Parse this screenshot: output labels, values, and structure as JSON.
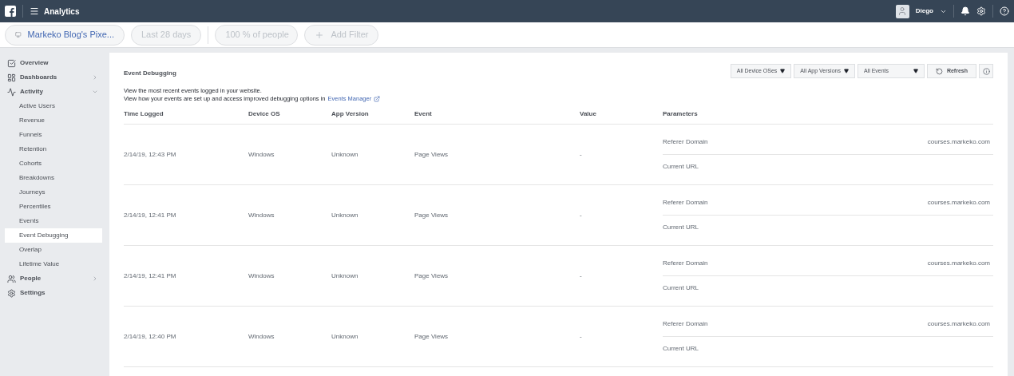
{
  "top_bar": {
    "title": "Analytics",
    "user": "Diego"
  },
  "filter_bar": [
    {
      "kind": "source",
      "label": "Markeko Blog's Pixe...",
      "disabled": false
    },
    {
      "kind": "plain",
      "label": "Last 28 days",
      "disabled": true
    },
    {
      "kind": "dropdown",
      "label": "100 % of people",
      "disabled": true
    },
    {
      "kind": "add",
      "label": "Add Filter",
      "disabled": true
    }
  ],
  "sidebar": {
    "items": [
      {
        "label": "Overview",
        "selected": false
      },
      {
        "label": "Dashboards",
        "selected": false,
        "expanded": false
      },
      {
        "label": "Activity",
        "selected": false,
        "expanded": true,
        "children": [
          {
            "label": "Active Users",
            "selected": false
          },
          {
            "label": "Revenue",
            "selected": false
          },
          {
            "label": "Funnels",
            "selected": false
          },
          {
            "label": "Retention",
            "selected": false
          },
          {
            "label": "Cohorts",
            "selected": false
          },
          {
            "label": "Breakdowns",
            "selected": false
          },
          {
            "label": "Journeys",
            "selected": false
          },
          {
            "label": "Percentiles",
            "selected": false
          },
          {
            "label": "Events",
            "selected": false
          },
          {
            "label": "Event Debugging",
            "selected": true
          },
          {
            "label": "Overlap",
            "selected": false
          },
          {
            "label": "Lifetime Value",
            "selected": false
          }
        ]
      },
      {
        "label": "People",
        "selected": false,
        "expanded": false
      },
      {
        "label": "Settings",
        "selected": false
      }
    ]
  },
  "panel": {
    "title": "Event Debugging",
    "filters": [
      "All Device OSes",
      "All App Versions",
      "All Events"
    ],
    "refresh": "Refresh",
    "description": "View the most recent events logged in your website.",
    "description_2": "View how your events are set up and access improved debugging options in",
    "link": "Events Manager",
    "table": {
      "columns": [
        "Time Logged",
        "Device OS",
        "App Version",
        "Event",
        "Value",
        "Parameters"
      ],
      "rows": [
        {
          "time": "2/14/19, 12:43 PM",
          "device_os": "Windows",
          "app_version": "Unknown",
          "event": "Page Views",
          "value": "-",
          "parameters": [
            {
              "name": "Referer Domain",
              "value": "courses.markeko.com"
            },
            {
              "name": "Current URL"
            }
          ]
        },
        {
          "time": "2/14/19, 12:41 PM",
          "device_os": "Windows",
          "app_version": "Unknown",
          "event": "Page Views",
          "value": "-",
          "parameters": [
            {
              "name": "Referer Domain",
              "value": "courses.markeko.com"
            },
            {
              "name": "Current URL"
            }
          ]
        },
        {
          "time": "2/14/19, 12:41 PM",
          "device_os": "Windows",
          "app_version": "Unknown",
          "event": "Page Views",
          "value": "-",
          "parameters": [
            {
              "name": "Referer Domain",
              "value": "courses.markeko.com"
            },
            {
              "name": "Current URL"
            }
          ]
        },
        {
          "time": "2/14/19, 12:40 PM",
          "device_os": "Windows",
          "app_version": "Unknown",
          "event": "Page Views",
          "value": "-",
          "parameters": [
            {
              "name": "Referer Domain",
              "value": "courses.markeko.com"
            },
            {
              "name": "Current URL"
            }
          ]
        }
      ]
    }
  }
}
